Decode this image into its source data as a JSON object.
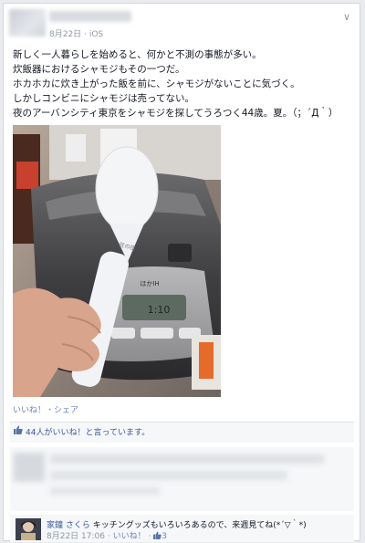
{
  "post": {
    "meta_date": "8月22日",
    "meta_separator": "·",
    "meta_platform": "iOS",
    "options": "∨",
    "lines": [
      "新しく一人暮らしを始めると、何かと不測の事態が多い。",
      "炊飯器におけるシャモジもその一つだ。",
      "ホカホカに炊き上がった飯を前に、シャモジがないことに気づく。",
      "しかしコンビニにシャモジは売ってない。",
      "夜のアーバンシティ東京をシャモジを探してうろつく44歳。夏。（；´Д｀）"
    ],
    "actions": {
      "like": "いいね！",
      "separator": "・",
      "share": "シェア"
    }
  },
  "likes": {
    "text": "44人がいいね！と言っています。"
  },
  "comment": {
    "author": "家鐘 さくら",
    "text": "キッチングッズもいろいろあるので、来週見てね(*´▽｀*)",
    "date": "8月22日 17:06",
    "separator": "·",
    "like": "いいね！",
    "like_count": "3"
  },
  "photo_labels": {
    "rice_cooker": "ほかIH",
    "display": "1:10",
    "brand_badge": "匠の技"
  },
  "colors": {
    "link": "#3b5998",
    "meta": "#9197a3"
  }
}
